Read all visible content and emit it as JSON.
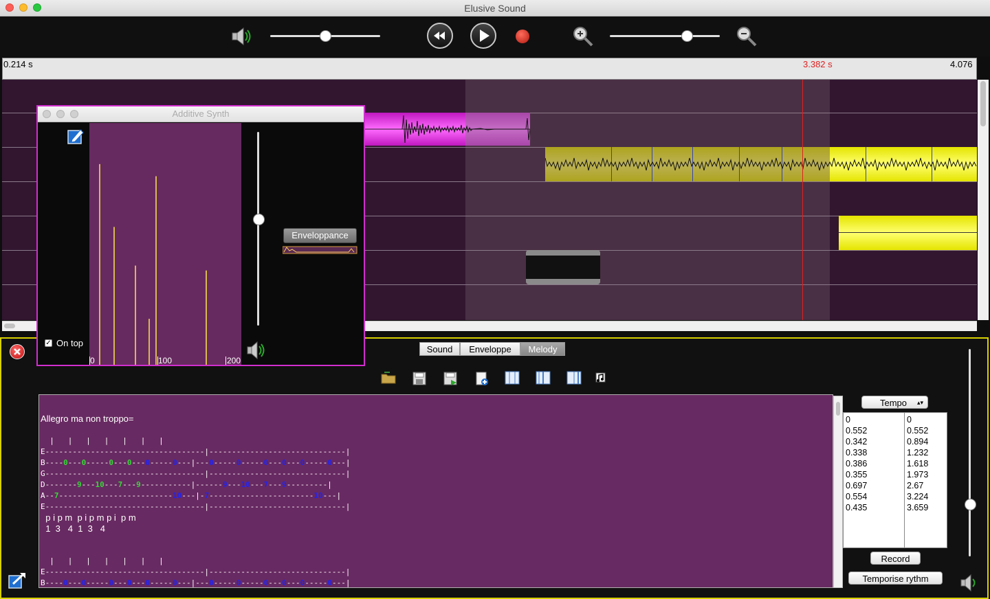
{
  "window": {
    "title": "Elusive Sound"
  },
  "toolbar": {
    "volume_level": 0.5,
    "zoom_level": 0.7
  },
  "ruler": {
    "start": "0.214 s",
    "cursor": "3.382 s",
    "end": "4.076"
  },
  "synth": {
    "title": "Additive Synth",
    "envelope_button": "Enveloppance",
    "on_top_label": "On top",
    "on_top_checked": true,
    "volume_level": 0.55,
    "freq_ticks": [
      "0",
      "100",
      "200"
    ],
    "partials": [
      0.83,
      0.57,
      0.41,
      0.19,
      0.78,
      0.39
    ]
  },
  "tabs": {
    "items": [
      "Sound",
      "Enveloppe",
      "Melody"
    ],
    "selected": "Melody"
  },
  "melody": {
    "heading": "Allegro ma non troppo=",
    "bars1": "  |   |   |   |   |   |   |",
    "fingers": "  p i p m  p i p m p i  p m",
    "numbers": "  1  3   4  1  3   4",
    "bars2": "  |   |   |   |   |   |   |"
  },
  "tempo": {
    "selector": "Tempo",
    "col1": [
      "0",
      "0.552",
      "0.342",
      "0.338",
      "0.386",
      "0.355",
      "0.697",
      "0.554",
      "0.435"
    ],
    "col2": [
      "0",
      "0.552",
      "0.894",
      "1.232",
      "1.618",
      "1.973",
      "2.67",
      "3.224",
      "3.659"
    ],
    "record": "Record",
    "temporise": "Temporise rythm"
  },
  "colors": {
    "accent": "#d22ed0",
    "panel_border": "#d8d100",
    "cursor": "#e02020"
  }
}
